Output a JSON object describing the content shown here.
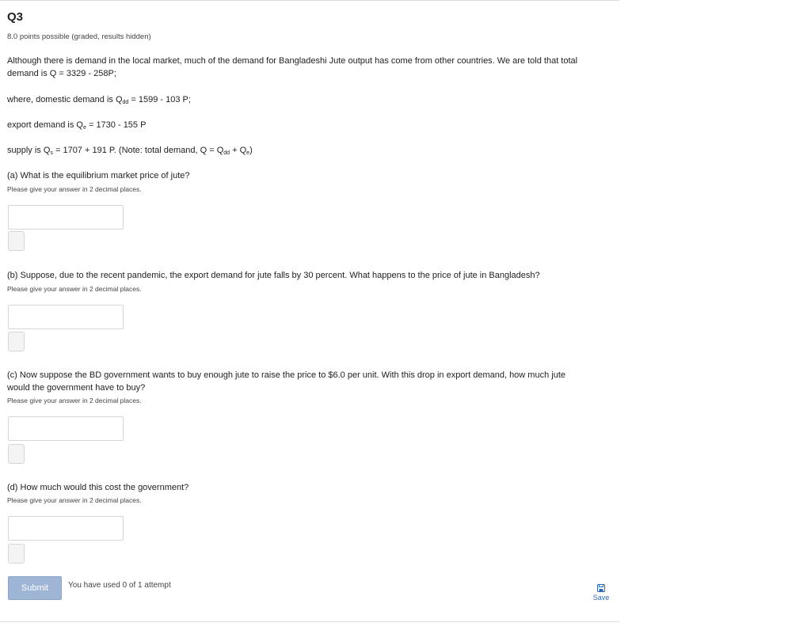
{
  "question": {
    "title": "Q3",
    "points": "8.0 points possible (graded, results hidden)"
  },
  "intro": {
    "line1": "Although there is demand in the local market, much of the demand for Bangladeshi Jute output has come from other countries. We are told that total",
    "line2": "demand is Q = 3329 - 258P;"
  },
  "equations": {
    "domestic_prefix": "where, domestic demand is Q",
    "domestic_sub": "dd",
    "domestic_rest": " = 1599 - 103 P;",
    "export_prefix": "export demand is Q",
    "export_sub": "e",
    "export_rest": " = 1730 - 155 P",
    "supply_prefix": "supply is Q",
    "supply_sub": "s",
    "supply_mid": " = 1707 + 191 P. (Note: total demand, Q = Q",
    "supply_sub2": "dd",
    "supply_mid2": " + Q",
    "supply_sub3": "e",
    "supply_end": ")"
  },
  "parts": {
    "a": {
      "question": "(a) What is the equilibrium market price of jute?",
      "hint": "Please give your answer in 2 decimal places.",
      "value": ""
    },
    "b": {
      "question": "(b) Suppose, due to the recent pandemic, the export demand for jute falls by 30 percent. What happens to the price of jute in Bangladesh?",
      "hint": "Please give your answer in 2 decimal places.",
      "value": ""
    },
    "c": {
      "question_line1": "(c) Now suppose the BD government wants to buy enough jute to raise the price to $6.0 per unit. With this drop in export demand, how much jute",
      "question_line2": "would the government have to buy?",
      "hint": "Please give your answer in 2 decimal places.",
      "value": ""
    },
    "d": {
      "question": "(d) How much would this cost the government?",
      "hint": "Please give your answer in 2 decimal places.",
      "value": ""
    }
  },
  "footer": {
    "submit_label": "Submit",
    "attempts_text": "You have used 0 of 1 attempt",
    "save_label": "Save",
    "save_icon": "floppy-disk-icon"
  },
  "colors": {
    "submit_bg": "#9eb5d6",
    "save_link": "#2d6ab3"
  }
}
